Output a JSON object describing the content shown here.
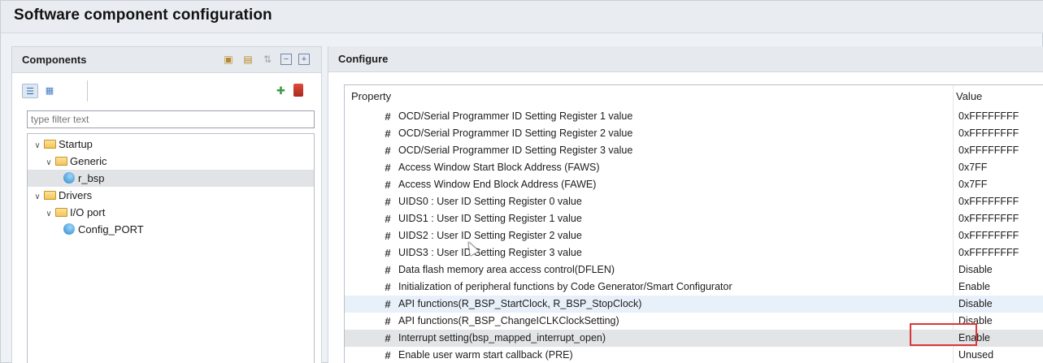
{
  "window": {
    "title": "Software component configuration"
  },
  "components": {
    "header": "Components",
    "header_icons": [
      "add-component-icon",
      "remove-component-icon",
      "sort-icon",
      "collapse-all-icon",
      "expand-all-icon"
    ],
    "filter_placeholder": "type filter text",
    "tree": [
      {
        "label": "Startup",
        "level": 0,
        "type": "folder",
        "expanded": true
      },
      {
        "label": "Generic",
        "level": 1,
        "type": "folder",
        "expanded": true
      },
      {
        "label": "r_bsp",
        "level": 2,
        "type": "component",
        "selected": true
      },
      {
        "label": "Drivers",
        "level": 0,
        "type": "folder",
        "expanded": true
      },
      {
        "label": "I/O port",
        "level": 1,
        "type": "folder",
        "expanded": true
      },
      {
        "label": "Config_PORT",
        "level": 2,
        "type": "component"
      }
    ]
  },
  "configure": {
    "header": "Configure",
    "columns": {
      "property": "Property",
      "value": "Value"
    },
    "rows": [
      {
        "name": "OCD/Serial Programmer ID Setting Register 1 value",
        "value": "0xFFFFFFFF"
      },
      {
        "name": "OCD/Serial Programmer ID Setting Register 2 value",
        "value": "0xFFFFFFFF"
      },
      {
        "name": "OCD/Serial Programmer ID Setting Register 3 value",
        "value": "0xFFFFFFFF"
      },
      {
        "name": "Access Window Start Block Address (FAWS)",
        "value": "0x7FF"
      },
      {
        "name": "Access Window End Block Address (FAWE)",
        "value": "0x7FF"
      },
      {
        "name": "UIDS0 : User ID Setting Register 0 value",
        "value": "0xFFFFFFFF"
      },
      {
        "name": "UIDS1 : User ID Setting Register 1 value",
        "value": "0xFFFFFFFF"
      },
      {
        "name": "UIDS2 : User ID Setting Register 2 value",
        "value": "0xFFFFFFFF"
      },
      {
        "name": "UIDS3 : User ID Setting Register 3 value",
        "value": "0xFFFFFFFF"
      },
      {
        "name": "Data flash memory area access control(DFLEN)",
        "value": "Disable"
      },
      {
        "name": "Initialization of peripheral functions by Code Generator/Smart Configurator",
        "value": "Enable"
      },
      {
        "name": "API functions(R_BSP_StartClock, R_BSP_StopClock)",
        "value": "Disable",
        "highlight": "blue"
      },
      {
        "name": "API functions(R_BSP_ChangeICLKClockSetting)",
        "value": "Disable"
      },
      {
        "name": "Interrupt setting(bsp_mapped_interrupt_open)",
        "value": "Enable",
        "highlight": "grey",
        "annotated": true
      },
      {
        "name": "Enable user warm start callback (PRE)",
        "value": "Unused"
      }
    ]
  },
  "colors": {
    "annotation_box": "#d9373a",
    "selection_grey": "#e3e4e6",
    "hover_blue": "#e8f1fa"
  }
}
